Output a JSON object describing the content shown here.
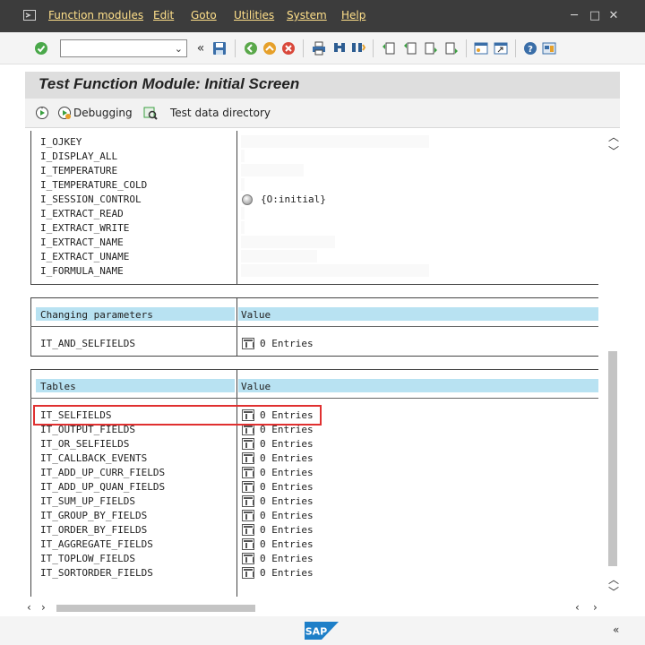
{
  "menu": {
    "items": [
      "Function modules",
      "Edit",
      "Goto",
      "Utilities",
      "System",
      "Help"
    ]
  },
  "window_controls": [
    "─",
    "□",
    "✕"
  ],
  "toolbar": {
    "command_field_value": "",
    "icons": [
      "check-icon",
      "back-arrows-icon",
      "save-icon",
      "back-icon",
      "exit-icon",
      "cancel-icon",
      "print-icon",
      "find-icon",
      "find-next-icon",
      "first-page-icon",
      "previous-page-icon",
      "next-page-icon",
      "last-page-icon",
      "create-session-icon",
      "shortcut-icon",
      "help-icon",
      "customize-layout-icon"
    ]
  },
  "title": "Test Function Module: Initial Screen",
  "app_toolbar": {
    "debugging_label": "Debugging",
    "test_data_label": "Test data directory"
  },
  "import_params": [
    {
      "name": "I_OJKEY",
      "value": ""
    },
    {
      "name": "I_DISPLAY_ALL",
      "value": ""
    },
    {
      "name": "I_TEMPERATURE",
      "value": ""
    },
    {
      "name": "I_TEMPERATURE_COLD",
      "value": ""
    },
    {
      "name": "I_SESSION_CONTROL",
      "value": "{O:initial}"
    },
    {
      "name": "I_EXTRACT_READ",
      "value": ""
    },
    {
      "name": "I_EXTRACT_WRITE",
      "value": ""
    },
    {
      "name": "I_EXTRACT_NAME",
      "value": ""
    },
    {
      "name": "I_EXTRACT_UNAME",
      "value": ""
    },
    {
      "name": "I_FORMULA_NAME",
      "value": ""
    }
  ],
  "changing": {
    "header_name": "Changing parameters",
    "header_value": "Value",
    "rows": [
      {
        "name": "IT_AND_SELFIELDS",
        "value": "0 Entries"
      }
    ]
  },
  "tables": {
    "header_name": "Tables",
    "header_value": "Value",
    "rows": [
      {
        "name": "IT_SELFIELDS",
        "value": "0 Entries"
      },
      {
        "name": "IT_OUTPUT_FIELDS",
        "value": "0 Entries"
      },
      {
        "name": "IT_OR_SELFIELDS",
        "value": "0 Entries"
      },
      {
        "name": "IT_CALLBACK_EVENTS",
        "value": "0 Entries"
      },
      {
        "name": "IT_ADD_UP_CURR_FIELDS",
        "value": "0 Entries"
      },
      {
        "name": "IT_ADD_UP_QUAN_FIELDS",
        "value": "0 Entries"
      },
      {
        "name": "IT_SUM_UP_FIELDS",
        "value": "0 Entries"
      },
      {
        "name": "IT_GROUP_BY_FIELDS",
        "value": "0 Entries"
      },
      {
        "name": "IT_ORDER_BY_FIELDS",
        "value": "0 Entries"
      },
      {
        "name": "IT_AGGREGATE_FIELDS",
        "value": "0 Entries"
      },
      {
        "name": "IT_TOPLOW_FIELDS",
        "value": "0 Entries"
      },
      {
        "name": "IT_SORTORDER_FIELDS",
        "value": "0 Entries"
      }
    ]
  },
  "status": {
    "logo_text": "SAP"
  },
  "colors": {
    "menubar": "#3c3c3c",
    "menu_text": "#ffe08a",
    "header_cell": "#b8e2f2",
    "highlight": "#e03030"
  }
}
